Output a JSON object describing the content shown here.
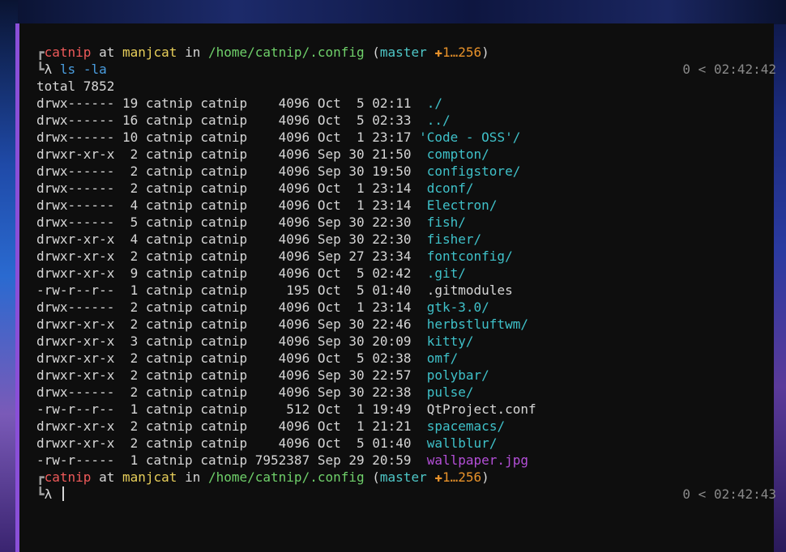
{
  "prompt": {
    "corner_top": "┏",
    "corner_bottom": "┗",
    "lambda": "λ",
    "user": "catnip",
    "at": "at",
    "host": "manjcat",
    "in": "in",
    "path": "/home/catnip/.config",
    "paren_open": "(",
    "branch": "master",
    "git_status": "✚1…256",
    "paren_close": ")"
  },
  "command": "ls -la",
  "rprompt_1": "0 < 02:42:42",
  "rprompt_2": "0 < 02:42:43",
  "total": "total 7852",
  "entries": [
    {
      "perms": "drwx------",
      "links": "19",
      "owner": "catnip",
      "group": "catnip",
      "size": "4096",
      "month": "Oct",
      "day": "5",
      "time": "02:11",
      "name": "./",
      "kind": "dir"
    },
    {
      "perms": "drwx------",
      "links": "16",
      "owner": "catnip",
      "group": "catnip",
      "size": "4096",
      "month": "Oct",
      "day": "5",
      "time": "02:33",
      "name": "../",
      "kind": "dir"
    },
    {
      "perms": "drwx------",
      "links": "10",
      "owner": "catnip",
      "group": "catnip",
      "size": "4096",
      "month": "Oct",
      "day": "1",
      "time": "23:17",
      "name": "'Code - OSS'/",
      "kind": "dir",
      "quoted": true
    },
    {
      "perms": "drwxr-xr-x",
      "links": "2",
      "owner": "catnip",
      "group": "catnip",
      "size": "4096",
      "month": "Sep",
      "day": "30",
      "time": "21:50",
      "name": "compton/",
      "kind": "dir"
    },
    {
      "perms": "drwx------",
      "links": "2",
      "owner": "catnip",
      "group": "catnip",
      "size": "4096",
      "month": "Sep",
      "day": "30",
      "time": "19:50",
      "name": "configstore/",
      "kind": "dir"
    },
    {
      "perms": "drwx------",
      "links": "2",
      "owner": "catnip",
      "group": "catnip",
      "size": "4096",
      "month": "Oct",
      "day": "1",
      "time": "23:14",
      "name": "dconf/",
      "kind": "dir"
    },
    {
      "perms": "drwx------",
      "links": "4",
      "owner": "catnip",
      "group": "catnip",
      "size": "4096",
      "month": "Oct",
      "day": "1",
      "time": "23:14",
      "name": "Electron/",
      "kind": "dir"
    },
    {
      "perms": "drwx------",
      "links": "5",
      "owner": "catnip",
      "group": "catnip",
      "size": "4096",
      "month": "Sep",
      "day": "30",
      "time": "22:30",
      "name": "fish/",
      "kind": "dir"
    },
    {
      "perms": "drwxr-xr-x",
      "links": "4",
      "owner": "catnip",
      "group": "catnip",
      "size": "4096",
      "month": "Sep",
      "day": "30",
      "time": "22:30",
      "name": "fisher/",
      "kind": "dir"
    },
    {
      "perms": "drwxr-xr-x",
      "links": "2",
      "owner": "catnip",
      "group": "catnip",
      "size": "4096",
      "month": "Sep",
      "day": "27",
      "time": "23:34",
      "name": "fontconfig/",
      "kind": "dir"
    },
    {
      "perms": "drwxr-xr-x",
      "links": "9",
      "owner": "catnip",
      "group": "catnip",
      "size": "4096",
      "month": "Oct",
      "day": "5",
      "time": "02:42",
      "name": ".git/",
      "kind": "dir"
    },
    {
      "perms": "-rw-r--r--",
      "links": "1",
      "owner": "catnip",
      "group": "catnip",
      "size": "195",
      "month": "Oct",
      "day": "5",
      "time": "01:40",
      "name": ".gitmodules",
      "kind": "file"
    },
    {
      "perms": "drwx------",
      "links": "2",
      "owner": "catnip",
      "group": "catnip",
      "size": "4096",
      "month": "Oct",
      "day": "1",
      "time": "23:14",
      "name": "gtk-3.0/",
      "kind": "dir"
    },
    {
      "perms": "drwxr-xr-x",
      "links": "2",
      "owner": "catnip",
      "group": "catnip",
      "size": "4096",
      "month": "Sep",
      "day": "30",
      "time": "22:46",
      "name": "herbstluftwm/",
      "kind": "dir"
    },
    {
      "perms": "drwxr-xr-x",
      "links": "3",
      "owner": "catnip",
      "group": "catnip",
      "size": "4096",
      "month": "Sep",
      "day": "30",
      "time": "20:09",
      "name": "kitty/",
      "kind": "dir"
    },
    {
      "perms": "drwxr-xr-x",
      "links": "2",
      "owner": "catnip",
      "group": "catnip",
      "size": "4096",
      "month": "Oct",
      "day": "5",
      "time": "02:38",
      "name": "omf/",
      "kind": "dir"
    },
    {
      "perms": "drwxr-xr-x",
      "links": "2",
      "owner": "catnip",
      "group": "catnip",
      "size": "4096",
      "month": "Sep",
      "day": "30",
      "time": "22:57",
      "name": "polybar/",
      "kind": "dir"
    },
    {
      "perms": "drwx------",
      "links": "2",
      "owner": "catnip",
      "group": "catnip",
      "size": "4096",
      "month": "Sep",
      "day": "30",
      "time": "22:38",
      "name": "pulse/",
      "kind": "dir"
    },
    {
      "perms": "-rw-r--r--",
      "links": "1",
      "owner": "catnip",
      "group": "catnip",
      "size": "512",
      "month": "Oct",
      "day": "1",
      "time": "19:49",
      "name": "QtProject.conf",
      "kind": "file"
    },
    {
      "perms": "drwxr-xr-x",
      "links": "2",
      "owner": "catnip",
      "group": "catnip",
      "size": "4096",
      "month": "Oct",
      "day": "1",
      "time": "21:21",
      "name": "spacemacs/",
      "kind": "dir"
    },
    {
      "perms": "drwxr-xr-x",
      "links": "2",
      "owner": "catnip",
      "group": "catnip",
      "size": "4096",
      "month": "Oct",
      "day": "5",
      "time": "01:40",
      "name": "wallblur/",
      "kind": "dir"
    },
    {
      "perms": "-rw-r-----",
      "links": "1",
      "owner": "catnip",
      "group": "catnip",
      "size": "7952387",
      "month": "Sep",
      "day": "29",
      "time": "20:59",
      "name": "wallpaper.jpg",
      "kind": "image"
    }
  ],
  "colors": {
    "background": "#0e0e0e",
    "border": "#8a4fd8",
    "user": "#ef5a5a",
    "host": "#e8cf5a",
    "path": "#6fd06a",
    "branch": "#4ec7c7",
    "git_status": "#e8922a",
    "command": "#4a9ee0",
    "directory": "#3fc1c9",
    "image": "#b44fd8",
    "text": "#d6d6d6"
  }
}
